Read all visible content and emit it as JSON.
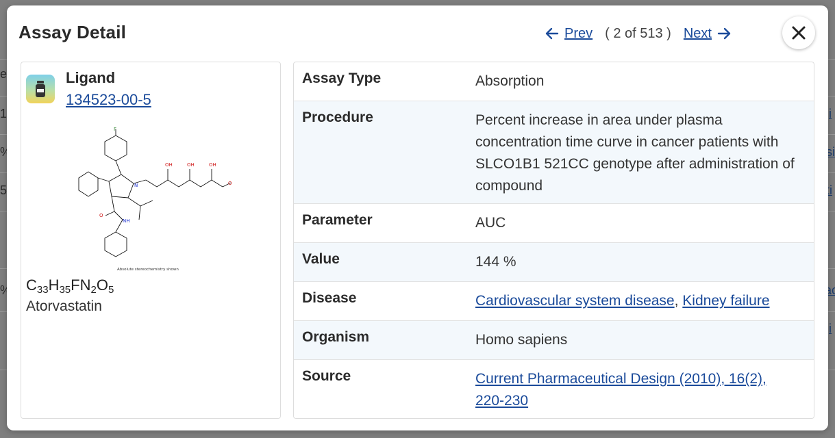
{
  "background": {
    "fragments_left": [
      "e",
      "1",
      "%",
      "5",
      "%"
    ],
    "fragments_right": [
      "i",
      "si",
      "ti",
      "",
      "ac",
      "",
      "i"
    ]
  },
  "modal": {
    "title": "Assay Detail",
    "pager": {
      "prev_label": "Prev",
      "next_label": "Next",
      "count": "( 2 of 513 )"
    },
    "close_icon": "close-icon"
  },
  "ligand": {
    "label": "Ligand",
    "id": "134523-00-5",
    "icon": "vial-icon",
    "formula": {
      "C": "33",
      "H": "35",
      "F": "",
      "N": "2",
      "O": "5"
    },
    "name": "Atorvastatin",
    "structure_caption": "Absolute stereochemistry shown",
    "atom_labels": [
      "F",
      "N",
      "NH",
      "O",
      "OH",
      "OH",
      "OH",
      "O"
    ]
  },
  "details": {
    "assay_type": {
      "key": "Assay Type",
      "value": "Absorption"
    },
    "procedure": {
      "key": "Procedure",
      "value": "Percent increase in area under plasma concentration time curve in cancer patients with SLCO1B1 521CC genotype after administration of compound"
    },
    "parameter": {
      "key": "Parameter",
      "value": "AUC"
    },
    "value": {
      "key": "Value",
      "value": "144 %"
    },
    "disease": {
      "key": "Disease",
      "links": [
        "Cardiovascular system disease",
        "Kidney failure"
      ],
      "separator": ", "
    },
    "organism": {
      "key": "Organism",
      "value": "Homo sapiens"
    },
    "source": {
      "key": "Source",
      "value": "Current Pharmaceutical Design (2010), 16(2), 220-230"
    }
  },
  "colors": {
    "link": "#1a4a9a",
    "alt_row": "#f3f8fc",
    "overlay": "#7f7f7f"
  }
}
